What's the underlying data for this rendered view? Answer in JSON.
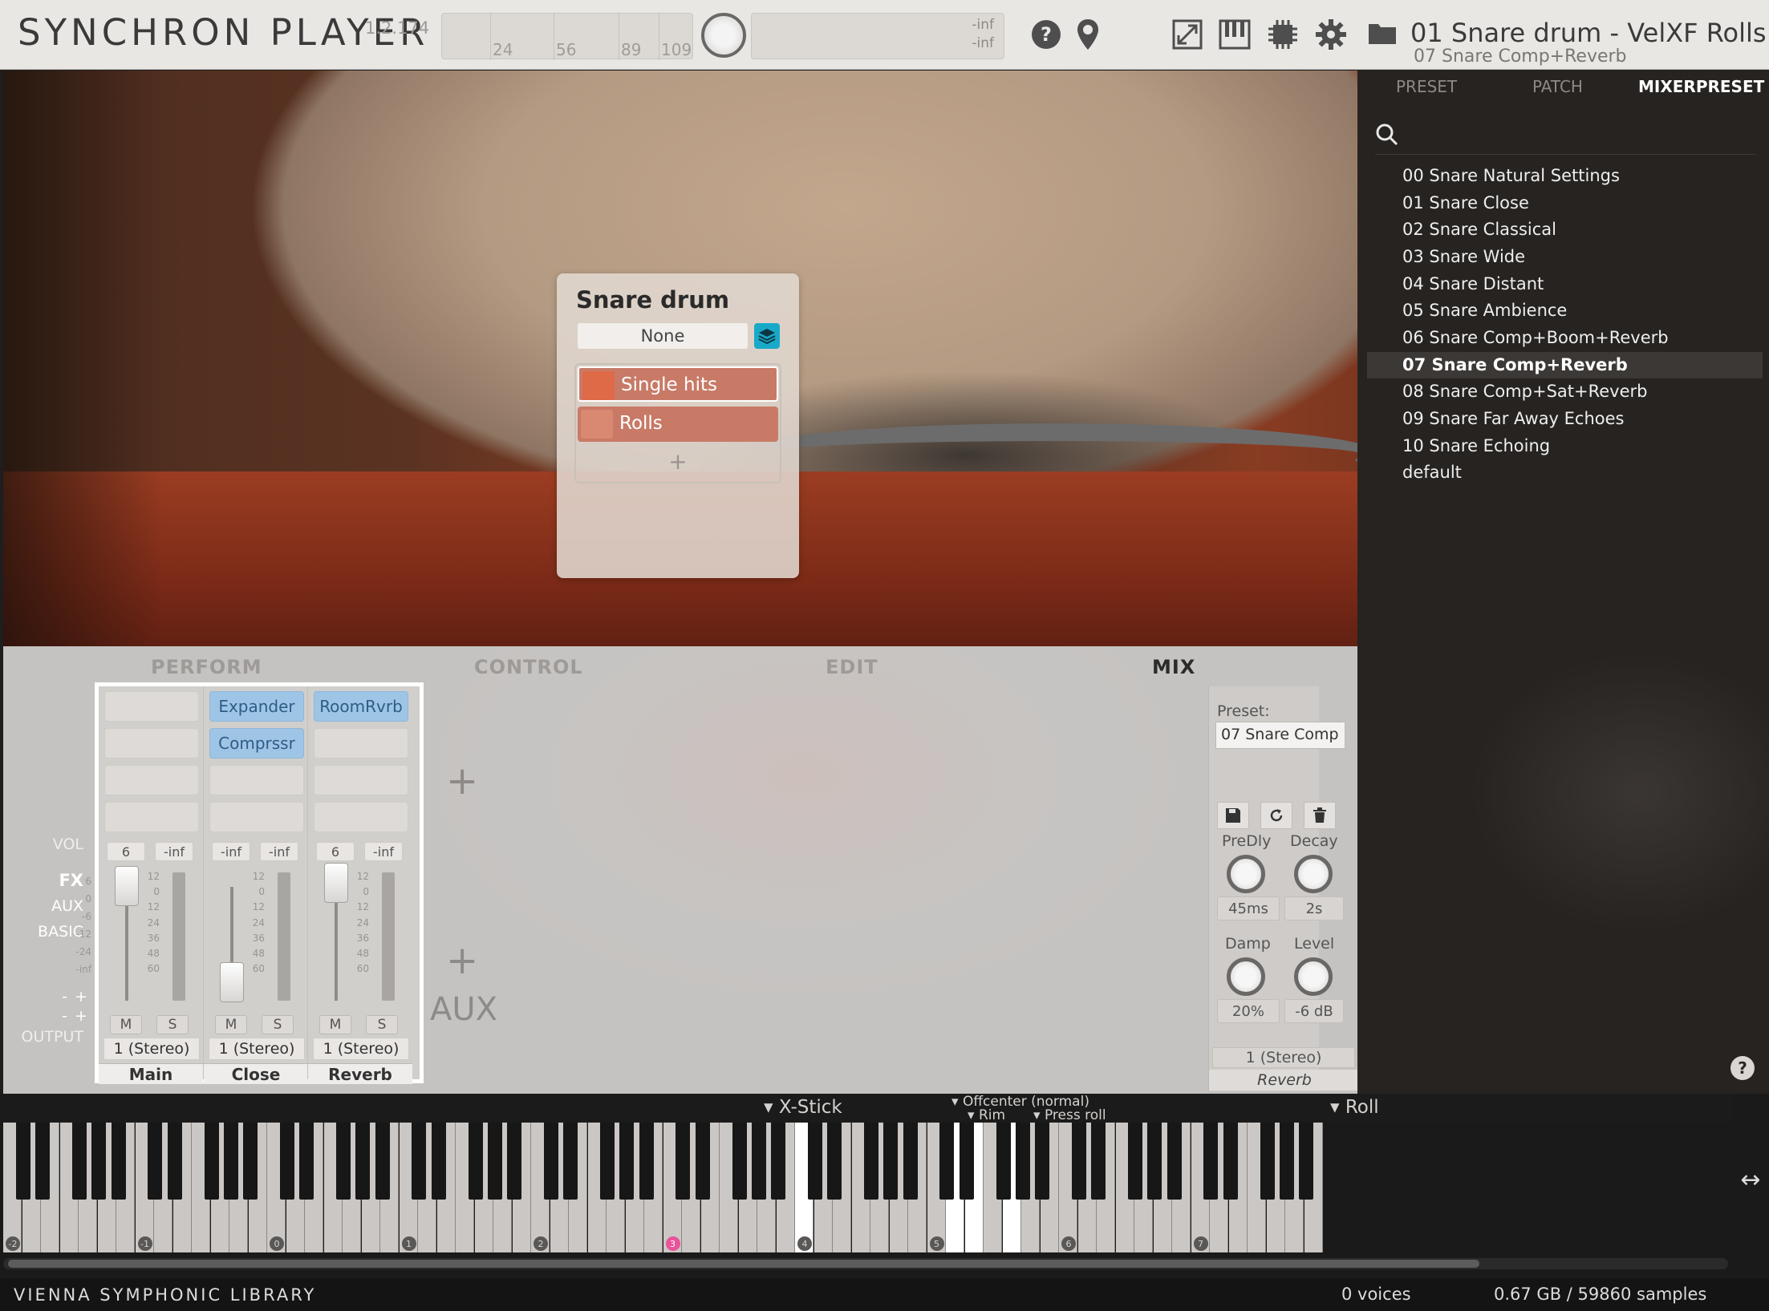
{
  "app": {
    "title": "SYNCHRON PLAYER",
    "version": "1.2.174",
    "velocity_ticks": [
      "24",
      "56",
      "89",
      "109"
    ],
    "meter": {
      "top": "-inf",
      "bottom": "-inf"
    },
    "instrument_title": "01 Snare drum - VelXF Rolls",
    "mixer_preset_subtitle": "07 Snare Comp+Reverb",
    "icons": [
      "help-icon",
      "location-pin-icon",
      "expand-icon",
      "keyboard-icon",
      "cpu-icon",
      "gear-icon",
      "folder-icon"
    ]
  },
  "articulation_popup": {
    "title": "Snare drum",
    "selector": "None",
    "items": [
      {
        "label": "Single hits",
        "selected": true
      },
      {
        "label": "Rolls",
        "selected": false
      }
    ],
    "add_symbol": "+"
  },
  "tabs": [
    "PERFORM",
    "CONTROL",
    "EDIT",
    "MIX"
  ],
  "active_tab": "MIX",
  "mixer_labels": {
    "vol": "VOL",
    "fx": "FX",
    "aux": "AUX",
    "basic": "BASIC",
    "minus1": "-",
    "plus1": "+",
    "minus2": "-",
    "plus2": "+",
    "output": "OUTPUT"
  },
  "scale_ticks": [
    "12",
    "0",
    "12",
    "24",
    "36",
    "48",
    "60"
  ],
  "left_scale_ticks": [
    "6",
    "0",
    "-6",
    "-12",
    "-24",
    "-inf"
  ],
  "strips": [
    {
      "name": "Main",
      "fx": [],
      "vol_left": "6",
      "vol_right": "-inf",
      "mute": "M",
      "solo": "S",
      "output": "1 (Stereo)"
    },
    {
      "name": "Close",
      "fx": [
        "Expander",
        "Comprssr"
      ],
      "vol_left": "-inf",
      "vol_right": "-inf",
      "mute": "M",
      "solo": "S",
      "output": "1 (Stereo)"
    },
    {
      "name": "Reverb",
      "fx": [
        "RoomRvrb"
      ],
      "vol_left": "6",
      "vol_right": "-inf",
      "mute": "M",
      "solo": "S",
      "output": "1 (Stereo)"
    }
  ],
  "add_symbol": "+",
  "aux_label": "AUX",
  "fx_panel": {
    "preset_label": "Preset:",
    "preset_value": "07 Snare Comp",
    "knobs": [
      {
        "label": "PreDly",
        "value": "45ms"
      },
      {
        "label": "Decay",
        "value": "2s"
      },
      {
        "label": "Damp",
        "value": "20%"
      },
      {
        "label": "Level",
        "value": "-6 dB"
      }
    ],
    "output": "1 (Stereo)",
    "effect_name": "Reverb"
  },
  "sidebar": {
    "tabs": [
      "PRESET",
      "PATCH",
      "MIXERPRESET"
    ],
    "active_tab": "MIXERPRESET",
    "presets": [
      "00 Snare Natural Settings",
      "01 Snare Close",
      "02 Snare Classical",
      "03 Snare Wide",
      "04 Snare Distant",
      "05 Snare Ambience",
      "06 Snare Comp+Boom+Reverb",
      "07 Snare Comp+Reverb",
      "08 Snare Comp+Sat+Reverb",
      "09 Snare Far Away Echoes",
      "10 Snare Echoing",
      "default"
    ],
    "selected_preset": "07 Snare Comp+Reverb",
    "help_symbol": "?"
  },
  "keyboard": {
    "labels": {
      "xstick": "X-Stick",
      "offcenter": "Offcenter (normal)",
      "rim": "Rim",
      "press_roll": "Press roll",
      "roll": "Roll"
    },
    "octaves": [
      "-2",
      "-1",
      "0",
      "1",
      "2",
      "3",
      "4",
      "5",
      "6",
      "7"
    ],
    "highlighted_octave": "3",
    "resize_symbol": "↔"
  },
  "status": {
    "vendor": "VIENNA SYMPHONIC LIBRARY",
    "voices": "0 voices",
    "memory": "0.67 GB / 59860 samples"
  },
  "colors": {
    "accent_cyan": "#19a9c8",
    "articulation_orange": "#de6a48",
    "fx_slot_blue": "#9fc5e6",
    "octave_highlight": "#e9539a"
  }
}
